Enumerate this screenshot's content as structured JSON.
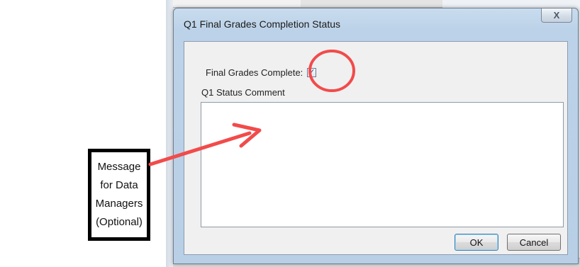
{
  "dialog": {
    "title": "Q1 Final Grades Completion Status",
    "close_icon": "close-icon",
    "close_glyph": "X"
  },
  "form": {
    "grades_complete_label": "Final Grades Complete:",
    "grades_complete_checked": true,
    "check_glyph": "✓",
    "comment_label": "Q1 Status Comment",
    "comment_value": ""
  },
  "buttons": {
    "ok_label": "OK",
    "cancel_label": "Cancel"
  },
  "annotation": {
    "text": "Message for Data Managers (Optional)",
    "color": "#f24b4b"
  },
  "colors": {
    "dialog_frame": "#bcd2e8",
    "dialog_body": "#f0f0f0",
    "ok_focus": "#3c7fb1"
  }
}
